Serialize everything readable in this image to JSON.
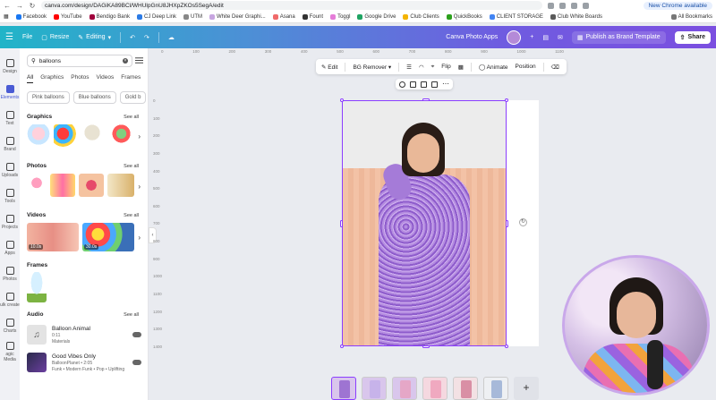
{
  "browser": {
    "url": "canva.com/design/DAGiKA89BCl/WHUlpGnU8JHXpZKOs5SegA/edit",
    "chrome_update": "New Chrome available",
    "bookmarks": [
      {
        "label": "Facebook",
        "color": "#1877f2"
      },
      {
        "label": "YouTube",
        "color": "#ff0000"
      },
      {
        "label": "Bendigo Bank",
        "color": "#a0003c"
      },
      {
        "label": "CJ Deep Link",
        "color": "#2c7be5"
      },
      {
        "label": "UTM",
        "color": "#888888"
      },
      {
        "label": "White Deer Graphi...",
        "color": "#c7a5e0"
      },
      {
        "label": "Asana",
        "color": "#f06a6a"
      },
      {
        "label": "Fount",
        "color": "#333333"
      },
      {
        "label": "Toggl",
        "color": "#e57cd8"
      },
      {
        "label": "Google Drive",
        "color": "#1fa463"
      },
      {
        "label": "Club Clients",
        "color": "#f4b400"
      },
      {
        "label": "QuickBooks",
        "color": "#2ca01c"
      },
      {
        "label": "CLIENT STORAGE",
        "color": "#4285f4"
      },
      {
        "label": "Club White Boards",
        "color": "#5a5a5a"
      }
    ],
    "all_bookmarks": "All Bookmarks"
  },
  "topbar": {
    "file": "File",
    "resize": "Resize",
    "editing": "Editing",
    "app_name": "Canva Photo Apps",
    "publish": "Publish as Brand Template",
    "share": "Share"
  },
  "rail": [
    {
      "label": "Design",
      "active": false
    },
    {
      "label": "Elements",
      "active": true
    },
    {
      "label": "Text",
      "active": false
    },
    {
      "label": "Brand",
      "active": false
    },
    {
      "label": "Uploads",
      "active": false
    },
    {
      "label": "Tools",
      "active": false
    },
    {
      "label": "Projects",
      "active": false
    },
    {
      "label": "Apps",
      "active": false
    },
    {
      "label": "Photos",
      "active": false
    },
    {
      "label": "ulk create",
      "active": false
    },
    {
      "label": "Charts",
      "active": false
    },
    {
      "label": "agic Media",
      "active": false
    }
  ],
  "panel": {
    "search_value": "balloons",
    "tabs": [
      "All",
      "Graphics",
      "Photos",
      "Videos",
      "Frames"
    ],
    "chips": [
      "Pink balloons",
      "Blue balloons",
      "Gold b"
    ],
    "sections": {
      "graphics": "Graphics",
      "photos": "Photos",
      "videos": "Videos",
      "frames": "Frames",
      "audio": "Audio",
      "see_all": "See all"
    },
    "video_durations": [
      "10.0s",
      "30.0s"
    ],
    "audio": [
      {
        "title": "Balloon Animal",
        "duration": "0:11",
        "artist": "Materials",
        "color": "#e3e3e3"
      },
      {
        "title": "Good Vibes Only",
        "duration": "BalloonPlanet • 2:05",
        "artist": "Funk • Modern Funk • Pop • Uplifting",
        "color": "#2a2a4a"
      }
    ]
  },
  "canvas_toolbar": {
    "edit": "Edit",
    "bg_remover": "BG Remover",
    "flip": "Flip",
    "animate": "Animate",
    "position": "Position"
  },
  "rulers": {
    "top": [
      "0",
      "100",
      "200",
      "300",
      "400",
      "500",
      "600",
      "700",
      "800",
      "900",
      "1000",
      "1100"
    ],
    "left": [
      "0",
      "100",
      "200",
      "300",
      "400",
      "500",
      "600",
      "700",
      "800",
      "900",
      "1000",
      "1100",
      "1200",
      "1300",
      "1400"
    ]
  },
  "pages": {
    "count": 6,
    "active_index": 0
  }
}
